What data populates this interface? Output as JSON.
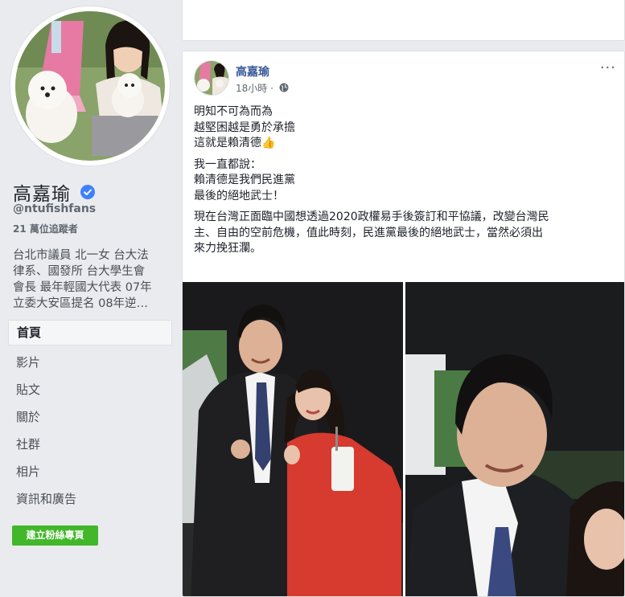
{
  "sidebar": {
    "page_name": "高嘉瑜",
    "handle": "@ntufishfans",
    "followers_count": "21",
    "followers_label": " 萬位追蹤者",
    "bio_lines": [
      "台北市議員 北一女 台大法",
      "律系、國發所 台大學生會",
      "會長 最年輕國大代表 07年",
      "立委大安區提名 08年逆…"
    ],
    "nav": [
      "首頁",
      "影片",
      "貼文",
      "關於",
      "社群",
      "相片",
      "資訊和廣告"
    ],
    "create_button": "建立粉絲專頁"
  },
  "post": {
    "author": "高嘉瑜",
    "time": "18小時",
    "sep": " · ",
    "more": "···",
    "para1": [
      "明知不可為而為",
      "越堅困越是勇於承擔",
      "這就是賴清德"
    ],
    "para2": [
      "我一直都說：",
      "賴清德是我們民進黨",
      "最後的絕地武士！"
    ],
    "para3": [
      "現在台灣正面臨中國想透過2020政權易手後簽訂和平協議，改變台灣民",
      "主、自由的空前危機，值此時刻，民進黨最後的絕地武士，當然必須出",
      "來力挽狂瀾。"
    ],
    "emoji": "👍"
  },
  "colors": {
    "link": "#385898",
    "green": "#42b72a",
    "verified": "#4080ff"
  }
}
